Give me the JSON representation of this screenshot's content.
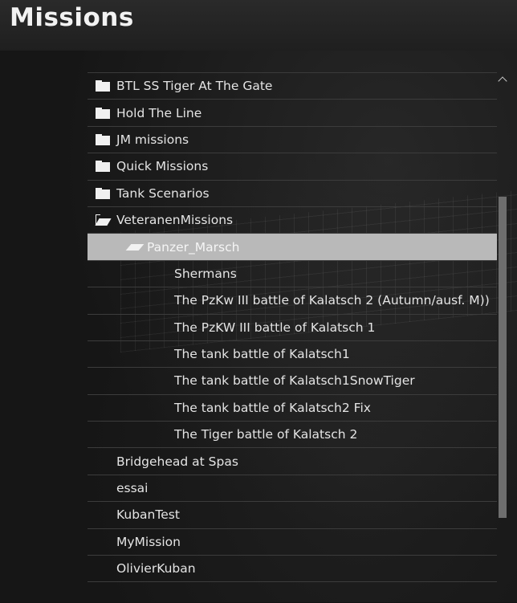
{
  "header": {
    "title": "Missions"
  },
  "tree": [
    {
      "label": "BTL SS Tiger At The Gate",
      "level": 0,
      "icon": "folder-closed-icon"
    },
    {
      "label": "Hold The Line",
      "level": 0,
      "icon": "folder-closed-icon"
    },
    {
      "label": "JM missions",
      "level": 0,
      "icon": "folder-closed-icon"
    },
    {
      "label": "Quick Missions",
      "level": 0,
      "icon": "folder-closed-icon"
    },
    {
      "label": "Tank Scenarios",
      "level": 0,
      "icon": "folder-closed-icon"
    },
    {
      "label": "VeteranenMissions",
      "level": 0,
      "icon": "folder-open-icon"
    },
    {
      "label": "Panzer_Marsch",
      "level": 1,
      "icon": "folder-open-flat-icon",
      "selected": true
    },
    {
      "label": "Shermans",
      "level": 2
    },
    {
      "label": "The PzKw III  battle of Kalatsch 2 (Autumn/ausf. M))",
      "level": 2
    },
    {
      "label": "The PzKW III battle of Kalatsch 1",
      "level": 2
    },
    {
      "label": "The tank battle of Kalatsch1",
      "level": 2
    },
    {
      "label": "The tank battle of Kalatsch1SnowTiger",
      "level": 2
    },
    {
      "label": "The tank battle of Kalatsch2 Fix",
      "level": 2
    },
    {
      "label": "The Tiger battle of Kalatsch 2",
      "level": 2
    },
    {
      "label": "Bridgehead at Spas",
      "level": 0
    },
    {
      "label": "essai",
      "level": 0
    },
    {
      "label": "KubanTest",
      "level": 0
    },
    {
      "label": "MyMission",
      "level": 0
    },
    {
      "label": "OlivierKuban",
      "level": 0
    }
  ],
  "scrollbar": {
    "up_icon": "chevron-up-icon"
  },
  "colors": {
    "selected_row": "#b9b9b9",
    "background": "#141414"
  }
}
